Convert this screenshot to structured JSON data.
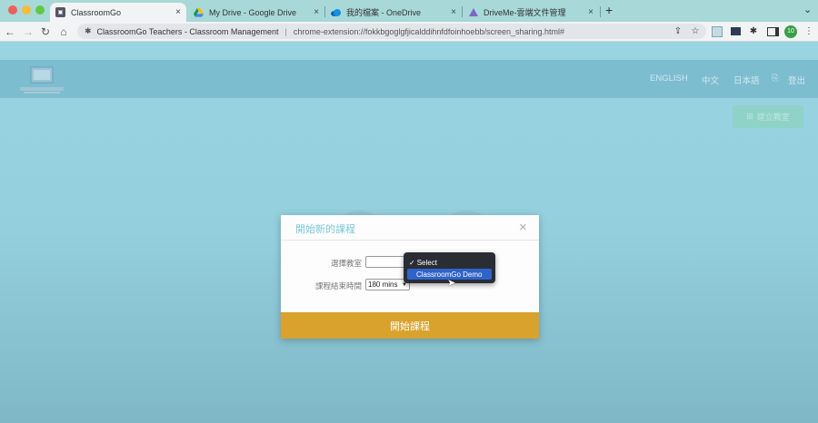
{
  "browser": {
    "tabs": [
      {
        "title": "ClassroomGo",
        "icon": "classroom-icon",
        "active": true
      },
      {
        "title": "My Drive - Google Drive",
        "icon": "google-drive-icon"
      },
      {
        "title": "我的檔案 - OneDrive",
        "icon": "onedrive-icon"
      },
      {
        "title": "DriveMe-雲端文件管理",
        "icon": "driveme-icon"
      }
    ],
    "new_tab": "+",
    "tab_menu": "⌄",
    "close": "×",
    "omnibox": {
      "site_title": "ClassroomGo Teachers - Classroom Management",
      "url": "chrome-extension://fokkbgoglgfjicalddihnfdfoinhoebb/screen_sharing.html#"
    },
    "profile_badge": "10"
  },
  "header": {
    "langs": [
      "ENGLISH",
      "中文",
      "日本語"
    ],
    "logout": "登出",
    "create_button": "建立教室"
  },
  "modal": {
    "title": "開始新的課程",
    "close": "×",
    "classroom_label": "選擇教室",
    "classroom_value": "",
    "end_time_label": "課程結束時間",
    "end_time_value": "180 mins",
    "start_button": "開始課程",
    "dropdown_options": [
      {
        "label": "Select",
        "checked": true
      },
      {
        "label": "ClassroomGo Demo",
        "highlighted": true
      }
    ]
  },
  "colors": {
    "accent": "#d9a22c",
    "title": "#7cc6da",
    "highlight": "#2f63c9"
  }
}
